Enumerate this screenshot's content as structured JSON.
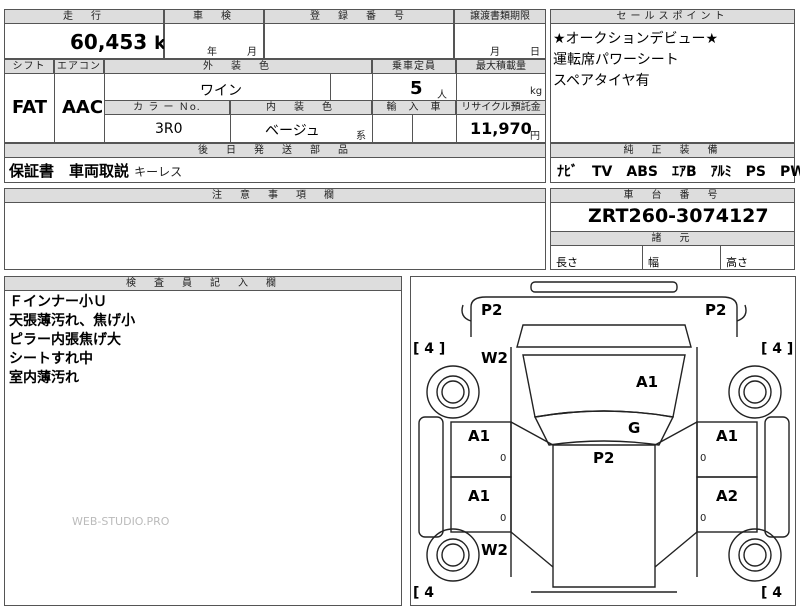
{
  "headers": {
    "mileage": "走　行",
    "inspection": "車　検",
    "registration": "登　録　番　号",
    "transfer_deadline": "譲渡書類期限",
    "sales_point": "セールスポイント",
    "shift": "シフト",
    "aircon": "エアコン",
    "exterior_color": "外　装　色",
    "capacity": "乗車定員",
    "max_load": "最大積載量",
    "color_no": "カ ラ ー Ｎo.",
    "interior_color": "内　装　色",
    "import": "輸　入　車",
    "recycle": "リサイクル預託金",
    "later_parts": "後　日　発　送　部　品",
    "options": "純　正　装　備",
    "notes": "注　意　事　項　欄",
    "chassis": "車　台　番　号",
    "dims": "諸　元",
    "inspector": "検　査　員　記　入　欄"
  },
  "values": {
    "mileage": "60,453",
    "mileage_unit": "km",
    "inspection_year_unit": "年",
    "inspection_month_unit": "月",
    "transfer_month_unit": "月",
    "transfer_day_unit": "日",
    "shift": "FAT",
    "aircon": "AAC",
    "exterior_color": "ワイン",
    "capacity": "5",
    "capacity_unit": "人",
    "max_load_unit": "kg",
    "color_no": "3R0",
    "interior_color": "ベージュ",
    "interior_suffix": "系",
    "recycle": "11,970",
    "recycle_unit": "円",
    "later_parts": "保証書　車両取説",
    "later_parts_small": "キーレス",
    "options": "ﾅﾋﾞ　TV　ABS　ｴｱB　ｱﾙﾐ　PS　PW",
    "chassis": "ZRT260-3074127",
    "length_label": "長さ",
    "width_label": "幅",
    "height_label": "高さ"
  },
  "sales_points": [
    "★オークションデビュー★",
    "運転席パワーシート",
    "スペアタイヤ有"
  ],
  "inspector_notes": [
    "Ｆインナー小Ｕ",
    "天張薄汚れ、焦げ小",
    "ピラー内張焦げ大",
    "シートすれ中",
    "室内薄汚れ"
  ],
  "watermark": "WEB-STUDIO.PRO",
  "diagram": {
    "p2_left": "P2",
    "p2_right": "P2",
    "w2_top": "W2",
    "w2_bottom": "W2",
    "a1_hood": "A1",
    "g": "G",
    "p2_roof": "P2",
    "a1_lf": "A1",
    "a1_rf": "A1",
    "a1_lr": "A1",
    "a2_rr": "A2",
    "tire_lt": "[ 4 ]",
    "tire_rt": "[ 4 ]",
    "tire_lb": "[ 4",
    "tire_rb": "[ 4",
    "zero": "0"
  }
}
